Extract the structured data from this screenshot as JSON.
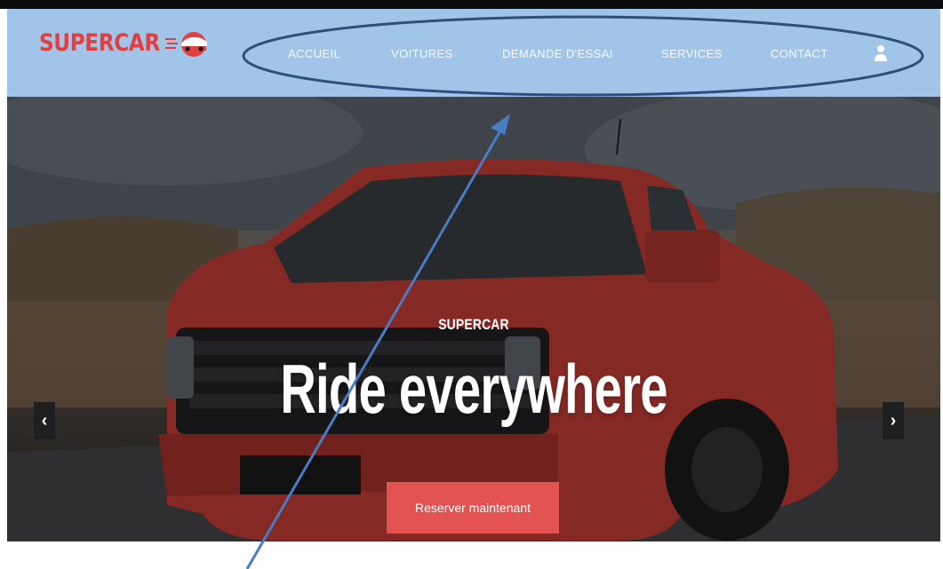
{
  "brand": {
    "name": "SUPERCAR",
    "color": "#e13f40",
    "logo_icon": "car-icon"
  },
  "nav": {
    "background": "#a1c5e8",
    "items": [
      {
        "label": "ACCUEIL"
      },
      {
        "label": "VOITURES"
      },
      {
        "label": "DEMANDE D'ESSAI"
      },
      {
        "label": "SERVICES"
      },
      {
        "label": "CONTACT"
      }
    ],
    "user_icon": "user-icon"
  },
  "hero": {
    "subtitle": "SUPERCAR",
    "title": "Ride everywhere",
    "cta_label": "Reserver maintenant",
    "cta_color": "#e25352",
    "prev_icon": "chevron-left-icon",
    "next_icon": "chevron-right-icon",
    "prev_glyph": "‹",
    "next_glyph": "›"
  },
  "annotation": {
    "color": "#2c4f7c",
    "shapes": [
      "ellipse-highlight",
      "arrow-pointer"
    ]
  }
}
